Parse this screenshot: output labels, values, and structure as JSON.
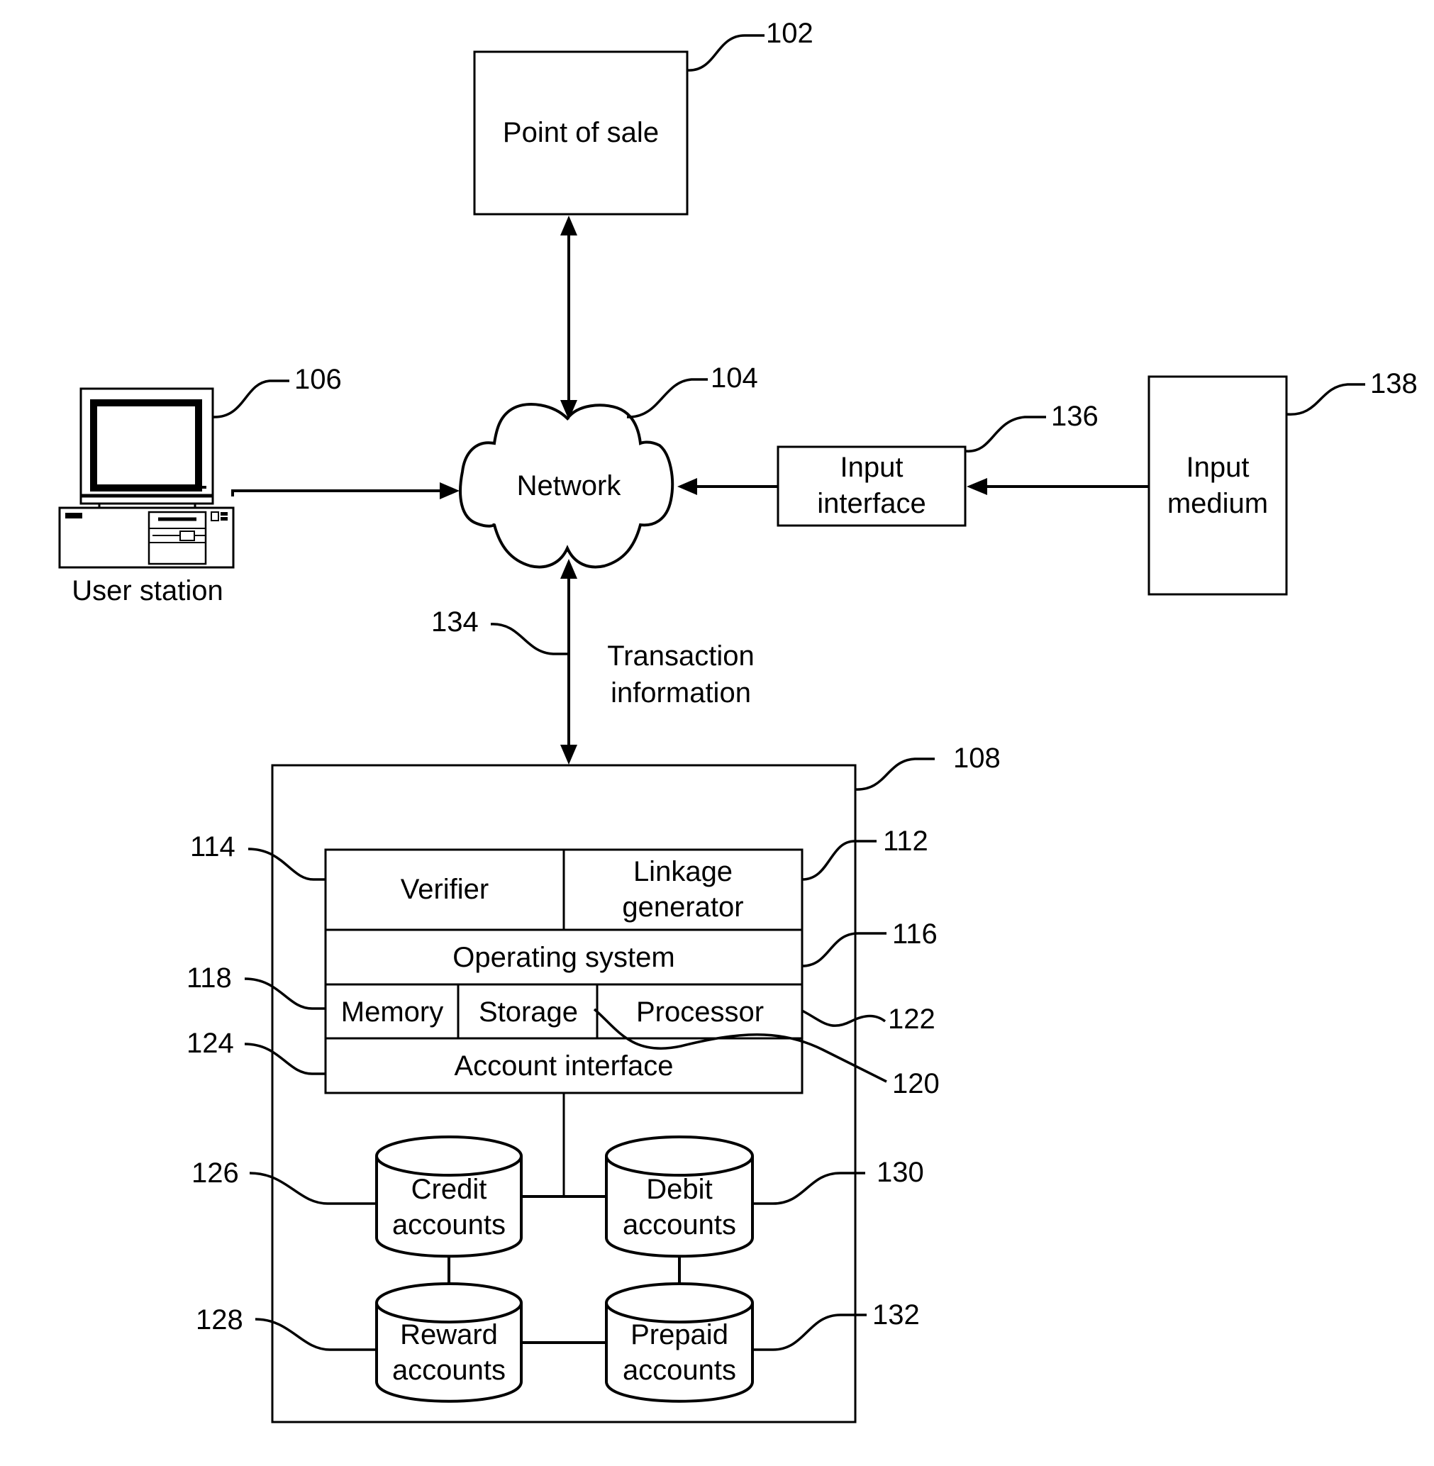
{
  "figure": {
    "nodes": {
      "point_of_sale": {
        "label": "Point of sale",
        "ref": "102"
      },
      "network": {
        "label": "Network",
        "ref": "104"
      },
      "user_station": {
        "label": "User station",
        "ref": "106"
      },
      "system": {
        "ref": "108"
      },
      "linkage_generator": {
        "label_line1": "Linkage",
        "label_line2": "generator",
        "ref": "112"
      },
      "verifier": {
        "label": "Verifier",
        "ref": "114"
      },
      "operating_system": {
        "label": "Operating system",
        "ref": "116"
      },
      "memory": {
        "label": "Memory",
        "ref": "118"
      },
      "storage": {
        "label": "Storage",
        "ref": "120"
      },
      "processor": {
        "label": "Processor",
        "ref": "122"
      },
      "account_interface": {
        "label": "Account interface",
        "ref": "124"
      },
      "credit_accounts": {
        "label_line1": "Credit",
        "label_line2": "accounts",
        "ref": "126"
      },
      "reward_accounts": {
        "label_line1": "Reward",
        "label_line2": "accounts",
        "ref": "128"
      },
      "debit_accounts": {
        "label_line1": "Debit",
        "label_line2": "accounts",
        "ref": "130"
      },
      "prepaid_accounts": {
        "label_line1": "Prepaid",
        "label_line2": "accounts",
        "ref": "132"
      },
      "input_interface": {
        "label_line1": "Input",
        "label_line2": "interface",
        "ref": "136"
      },
      "input_medium": {
        "label_line1": "Input",
        "label_line2": "medium",
        "ref": "138"
      }
    },
    "links": {
      "transaction": {
        "label_line1": "Transaction",
        "label_line2": "information",
        "ref": "134"
      }
    }
  }
}
